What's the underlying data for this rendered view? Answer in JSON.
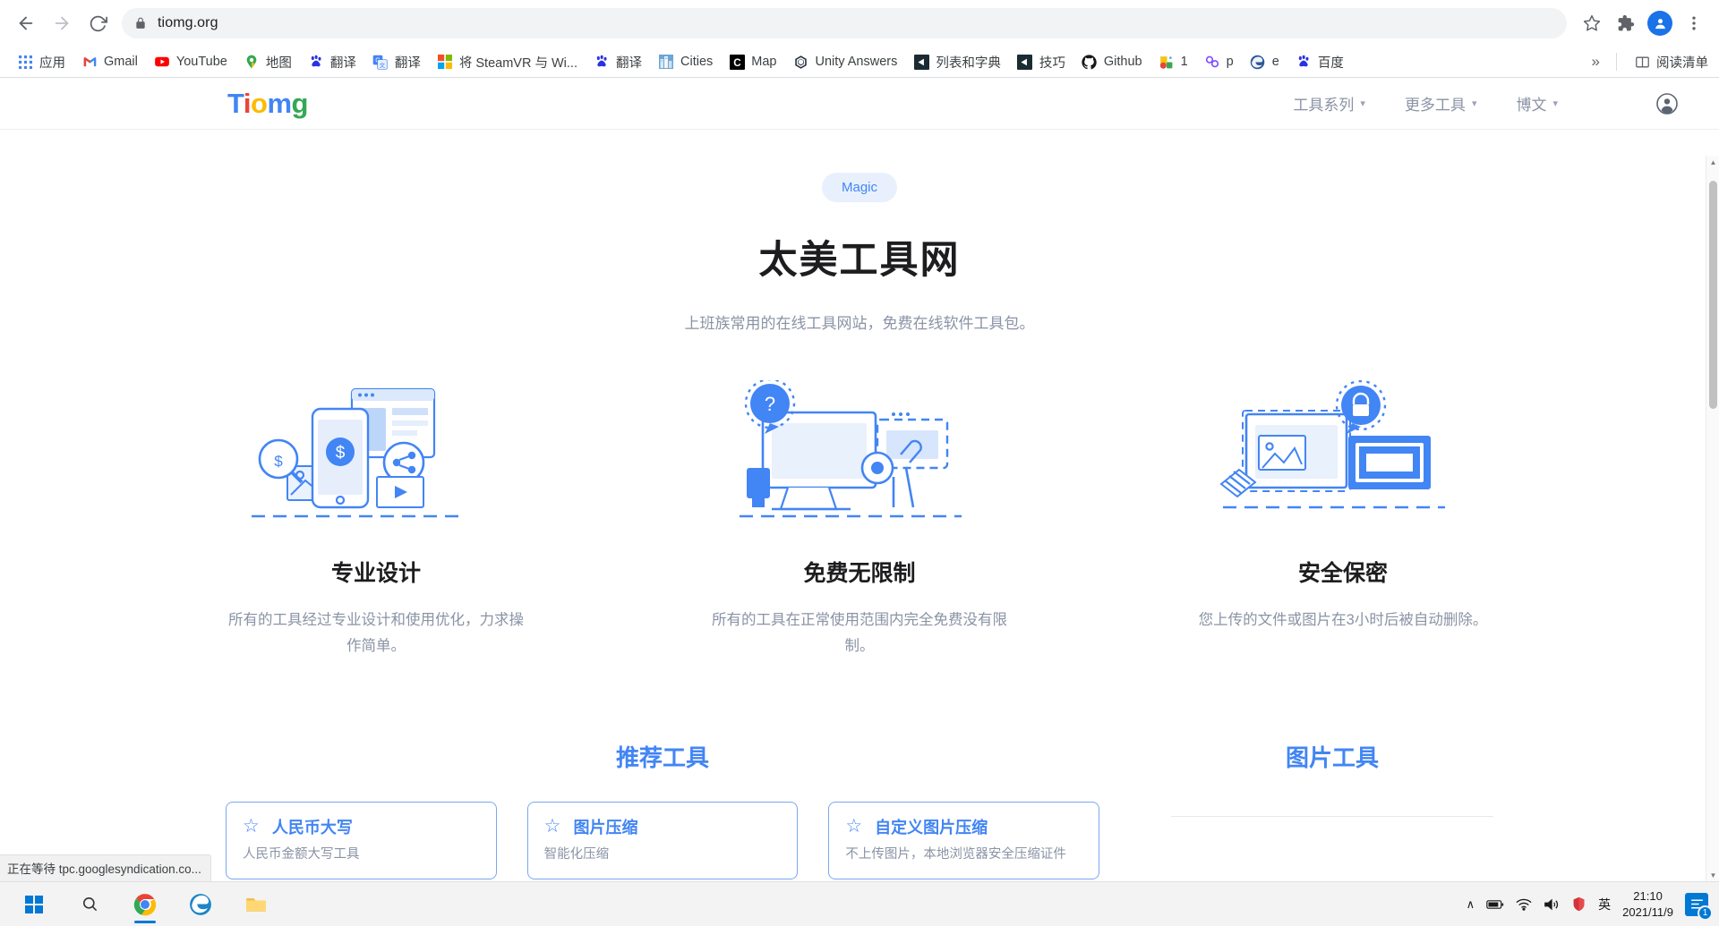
{
  "browser": {
    "url": "tiomg.org",
    "back_label": "Back",
    "forward_label": "Forward",
    "reload_label": "Reload",
    "bookmark_label": "Bookmark this tab",
    "extensions_label": "Extensions",
    "profile_initial": "",
    "menu_label": "Customize and control Google Chrome",
    "bookmarks": [
      {
        "label": "应用",
        "icon": "apps-grid-icon"
      },
      {
        "label": "Gmail",
        "icon": "gmail-icon"
      },
      {
        "label": "YouTube",
        "icon": "youtube-icon"
      },
      {
        "label": "地图",
        "icon": "maps-pin-icon"
      },
      {
        "label": "翻译",
        "icon": "baidu-paw-icon"
      },
      {
        "label": "翻译",
        "icon": "google-translate-icon"
      },
      {
        "label": "将 SteamVR 与 Wi...",
        "icon": "microsoft-icon"
      },
      {
        "label": "翻译",
        "icon": "baidu-paw-icon"
      },
      {
        "label": "Cities",
        "icon": "cities-icon"
      },
      {
        "label": "Map",
        "icon": "c-letter-icon"
      },
      {
        "label": "Unity Answers",
        "icon": "unity-icon"
      },
      {
        "label": "列表和字典",
        "icon": "unity-square-icon"
      },
      {
        "label": "技巧",
        "icon": "unity-square-icon"
      },
      {
        "label": "Github",
        "icon": "github-icon"
      },
      {
        "label": "1",
        "icon": "colorful-bookmark-icon"
      },
      {
        "label": "p",
        "icon": "purple-link-icon"
      },
      {
        "label": "e",
        "icon": "edge-icon"
      },
      {
        "label": "百度",
        "icon": "baidu-paw-icon"
      }
    ],
    "overflow_label": "»",
    "reading_list_label": "阅读清单",
    "status_text": "正在等待 tpc.googlesyndication.co..."
  },
  "site": {
    "logo_letters": [
      "T",
      "i",
      "o",
      "m",
      "g"
    ],
    "nav": [
      {
        "label": "工具系列",
        "caret": "▾"
      },
      {
        "label": "更多工具",
        "caret": "▾"
      },
      {
        "label": "博文",
        "caret": "▾"
      }
    ],
    "account_label": "账户"
  },
  "hero": {
    "badge": "Magic",
    "title": "太美工具网",
    "subtitle": "上班族常用的在线工具网站，免费在线软件工具包。"
  },
  "features": [
    {
      "icon": "design-devices-illustration",
      "title": "专业设计",
      "desc": "所有的工具经过专业设计和使用优化，力求操作简单。"
    },
    {
      "icon": "free-support-illustration",
      "title": "免费无限制",
      "desc": "所有的工具在正常使用范围内完全免费没有限制。"
    },
    {
      "icon": "security-privacy-illustration",
      "title": "安全保密",
      "desc": "您上传的文件或图片在3小时后被自动删除。"
    }
  ],
  "sections": {
    "recommended": {
      "title": "推荐工具",
      "cards": [
        {
          "star": "☆",
          "name": "人民币大写",
          "desc": "人民币金额大写工具"
        },
        {
          "star": "☆",
          "name": "图片压缩",
          "desc": "智能化压缩"
        },
        {
          "star": "☆",
          "name": "自定义图片压缩",
          "desc": "不上传图片，本地浏览器安全压缩证件"
        }
      ]
    },
    "image_tools": {
      "title": "图片工具"
    }
  },
  "taskbar": {
    "start_label": "开始",
    "search_label": "搜索",
    "apps": [
      {
        "name": "chrome-taskbar-icon",
        "active": true
      },
      {
        "name": "edge-taskbar-icon",
        "active": false
      },
      {
        "name": "file-explorer-taskbar-icon",
        "active": false
      }
    ],
    "tray": {
      "chevron": "∧",
      "battery": "battery-icon",
      "wifi": "wifi-icon",
      "volume": "volume-icon",
      "security": "security-icon",
      "ime": "英",
      "time": "21:10",
      "date": "2021/11/9",
      "notification_count": "1"
    }
  }
}
